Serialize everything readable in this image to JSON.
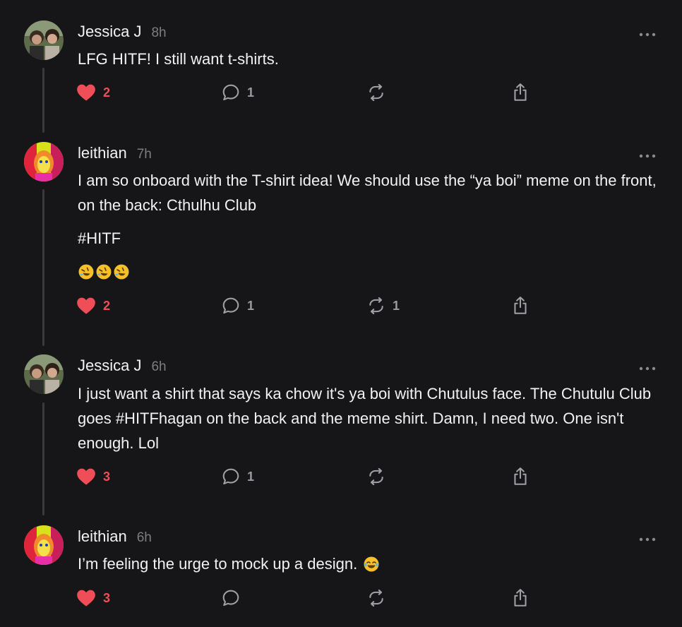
{
  "colors": {
    "background": "#161618",
    "text": "#f2f2f2",
    "muted": "#7d7d82",
    "like": "#ef4d57",
    "thread_line": "#3a3a3d"
  },
  "posts": [
    {
      "author": "Jessica J",
      "time": "8h",
      "paragraphs": [
        "LFG HITF! I still want t-shirts."
      ],
      "likes": "2",
      "replies": "1",
      "reposts": "",
      "avatar_icon": "person-photo-avatar"
    },
    {
      "author": "leithian",
      "time": "7h",
      "paragraphs": [
        "I am so onboard with the T-shirt idea! We should use the “ya boi” meme on the front, on the back: Cthulhu Club",
        "#HITF"
      ],
      "emoji": [
        "rolling-on-floor-laughing-emoji",
        "rolling-on-floor-laughing-emoji",
        "rolling-on-floor-laughing-emoji"
      ],
      "likes": "2",
      "replies": "1",
      "reposts": "1",
      "avatar_icon": "colorful-portrait-avatar"
    },
    {
      "author": "Jessica J",
      "time": "6h",
      "paragraphs": [
        "I just want a shirt that says ka chow it's ya boi with Chutulus face. The Chutulu Club goes #HITFhagan on the back and the meme shirt. Damn, I need two. One isn't enough. Lol"
      ],
      "likes": "3",
      "replies": "1",
      "reposts": "",
      "avatar_icon": "person-photo-avatar"
    },
    {
      "author": "leithian",
      "time": "6h",
      "paragraphs": [
        "I’m feeling the urge to mock up a design."
      ],
      "inline_emoji": "tears-of-joy-emoji",
      "likes": "3",
      "replies": "",
      "reposts": "",
      "avatar_icon": "colorful-portrait-avatar"
    }
  ]
}
